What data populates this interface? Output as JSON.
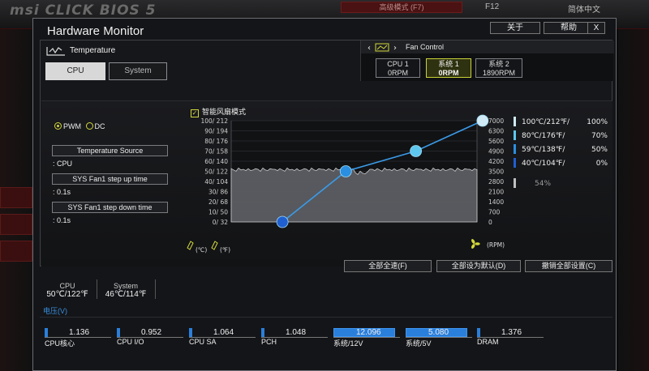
{
  "bios": {
    "logo": "msi CLICK BIOS 5",
    "advanced_mode": "高级模式 (F7)",
    "f12": "F12",
    "language": "简体中文"
  },
  "window": {
    "title": "Hardware Monitor",
    "about": "关于",
    "help": "帮助",
    "close": "X"
  },
  "temperature": {
    "label": "Temperature",
    "tabs": [
      "CPU",
      "System"
    ]
  },
  "fan_control": {
    "label": "Fan Control",
    "fans": [
      {
        "name": "CPU 1",
        "rpm": "0RPM"
      },
      {
        "name": "系统 1",
        "rpm": "0RPM"
      },
      {
        "name": "系统 2",
        "rpm": "1890RPM"
      }
    ]
  },
  "controls": {
    "pwm": "PWM",
    "dc": "DC",
    "temp_source_label": "Temperature Source",
    "temp_source_value": ": CPU",
    "step_up_label": "SYS Fan1 step up time",
    "step_up_value": ": 0.1s",
    "step_down_label": "SYS Fan1 step down time",
    "step_down_value": ": 0.1s",
    "smart_fan": "智能风扇模式"
  },
  "chart_data": {
    "type": "line",
    "left_ticks": [
      "100/ 212",
      "90/ 194",
      "80/ 176",
      "70/ 158",
      "60/ 140",
      "50/ 122",
      "40/ 104",
      "30/  86",
      "20/  68",
      "10/  50",
      "0/  32"
    ],
    "right_ticks": [
      "7000",
      "6300",
      "5600",
      "4900",
      "4200",
      "3500",
      "2800",
      "2100",
      "1400",
      "700",
      "0"
    ],
    "unit_left": "(℃)",
    "unit_left_f": "(℉)",
    "unit_right": "(RPM)",
    "ylim_temp": [
      0,
      100
    ],
    "ylim_rpm": [
      0,
      7000
    ],
    "curve": [
      {
        "temp": 40,
        "fan_pct": 0
      },
      {
        "temp": 59,
        "fan_pct": 50
      },
      {
        "temp": 80,
        "fan_pct": 70
      },
      {
        "temp": 100,
        "fan_pct": 100
      }
    ],
    "temp_trace_level": 52,
    "legend": [
      {
        "label": "100℃/212℉/",
        "value": "100%",
        "color": "#cfeaf5"
      },
      {
        "label": "80℃/176℉/",
        "value": "70%",
        "color": "#5ec7ee"
      },
      {
        "label": "59℃/138℉/",
        "value": "50%",
        "color": "#2a8fe0"
      },
      {
        "label": "40℃/104℉/",
        "value": "0%",
        "color": "#1f5fd0"
      },
      {
        "label": "",
        "value": "54%",
        "color": "#bfbfbf"
      }
    ]
  },
  "actions": {
    "full_speed": "全部全速(F)",
    "set_default": "全部设为默认(D)",
    "cancel_all": "撤销全部设置(C)"
  },
  "temps": [
    {
      "name": "CPU",
      "value": "50℃/122℉"
    },
    {
      "name": "System",
      "value": "46℃/114℉"
    }
  ],
  "voltage": {
    "label": "电压(V)",
    "items": [
      {
        "name": "CPU核心",
        "value": "1.136",
        "fill": 0.0
      },
      {
        "name": "CPU I/O",
        "value": "0.952",
        "fill": 0.0
      },
      {
        "name": "CPU SA",
        "value": "1.064",
        "fill": 0.0
      },
      {
        "name": "PCH",
        "value": "1.048",
        "fill": 0.0
      },
      {
        "name": "系统/12V",
        "value": "12.096",
        "fill": 1.0
      },
      {
        "name": "系统/5V",
        "value": "5.080",
        "fill": 1.0
      },
      {
        "name": "DRAM",
        "value": "1.376",
        "fill": 0.0
      }
    ]
  }
}
